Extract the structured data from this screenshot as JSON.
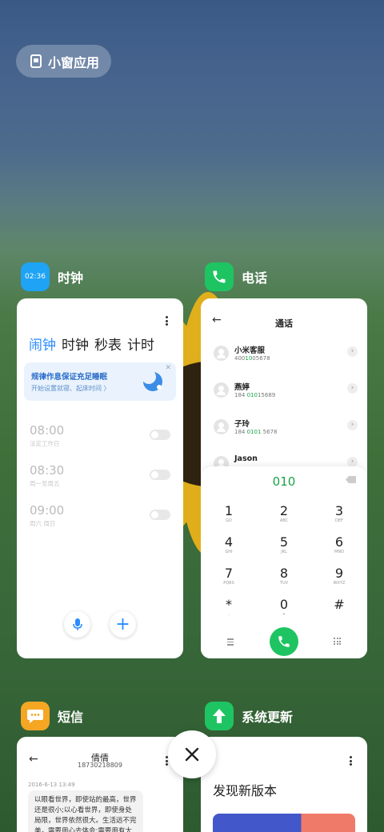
{
  "floating_window": {
    "label": "小窗应用"
  },
  "apps": {
    "clock": {
      "name": "时钟",
      "icon_time": "02:36",
      "icon_color": "#1ea3f5",
      "tabs": [
        "闹钟",
        "时钟",
        "秒表",
        "计时"
      ],
      "active_tab": 0,
      "banner": {
        "title": "规律作息保证充足睡眠",
        "subtitle": "开始设置就寝、起床时间 〉"
      },
      "alarms": [
        {
          "time": "08:00",
          "repeat": "法定工作日",
          "enabled": false
        },
        {
          "time": "08:30",
          "repeat": "周一至周五",
          "enabled": false
        },
        {
          "time": "09:00",
          "repeat": "周六 周日",
          "enabled": false
        }
      ]
    },
    "phone": {
      "name": "电话",
      "icon_color": "#1fc462",
      "title": "通话",
      "contacts": [
        {
          "name": "小米客服",
          "pre": "400",
          "match": "10",
          "post": "05678"
        },
        {
          "name": "燕婷",
          "pre": "184 ",
          "match": "010",
          "post": "15689"
        },
        {
          "name": "子玲",
          "pre": "184 ",
          "match": "0101",
          "post": " 5678"
        },
        {
          "name": "Jason",
          "pre": "",
          "match": "",
          "post": ""
        }
      ],
      "dialed": "010",
      "keys": [
        {
          "d": "1",
          "l": "GD"
        },
        {
          "d": "2",
          "l": "ABC"
        },
        {
          "d": "3",
          "l": "DEF"
        },
        {
          "d": "4",
          "l": "GHI"
        },
        {
          "d": "5",
          "l": "JKL"
        },
        {
          "d": "6",
          "l": "MNO"
        },
        {
          "d": "7",
          "l": "PQRS"
        },
        {
          "d": "8",
          "l": "TUV"
        },
        {
          "d": "9",
          "l": "WXYZ"
        },
        {
          "d": "*",
          "l": ","
        },
        {
          "d": "0",
          "l": "+"
        },
        {
          "d": "#",
          "l": ""
        }
      ]
    },
    "sms": {
      "name": "短信",
      "icon_color": "#f5a623",
      "contact_name": "倩倩",
      "contact_number": "18730218809",
      "date": "2016-6-13 13:49",
      "message": "以眼看世界，即使站的最高，世界还是很小;以心看世界，即使身处局限，世界依然很大。生活远不完美，需要用心去体会;需要用有大多，需"
    },
    "updater": {
      "name": "系统更新",
      "icon_color": "#1fc462",
      "heading": "发现新版本"
    }
  }
}
